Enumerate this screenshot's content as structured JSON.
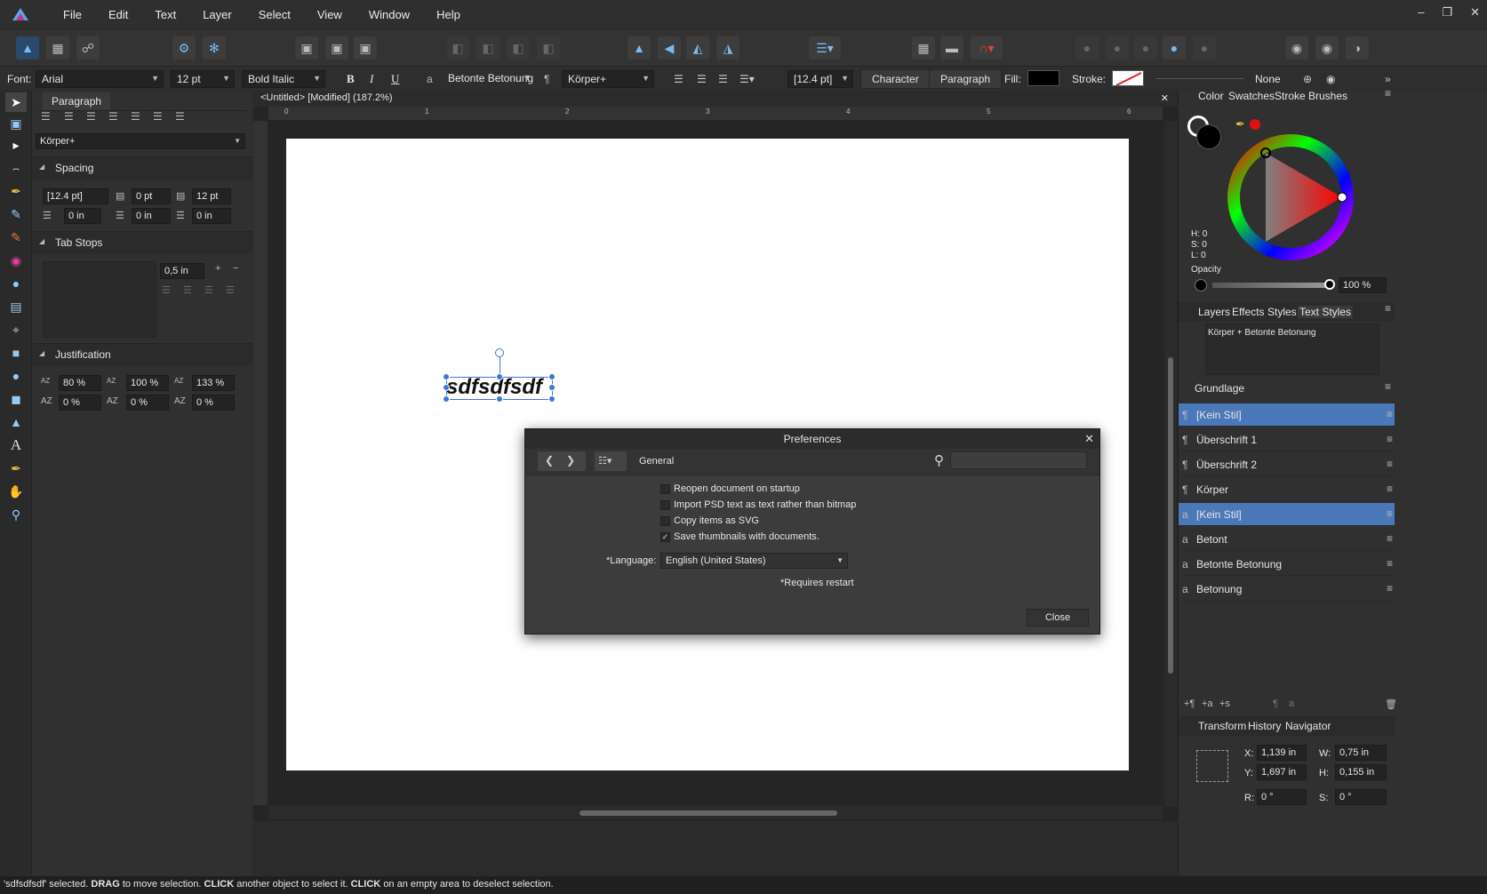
{
  "menu": [
    "File",
    "Edit",
    "Text",
    "Layer",
    "Select",
    "View",
    "Window",
    "Help"
  ],
  "context": {
    "font_label": "Font:",
    "font": "Arial",
    "size": "12 pt",
    "style": "Bold Italic",
    "bold": "B",
    "italic": "I",
    "underline": "U",
    "char_style": "Betonte Betonung",
    "para_style": "Körper+",
    "leading": "[12.4 pt]",
    "character_btn": "Character",
    "paragraph_btn": "Paragraph",
    "fill_label": "Fill:",
    "stroke_label": "Stroke:",
    "stroke_value": "None",
    "colors": {
      "fill": "#000000",
      "stroke_bg": "#ffffff",
      "stroke_slash": "#e02020"
    }
  },
  "paragraph_panel": {
    "tab": "Paragraph",
    "style": "Körper+",
    "spacing": {
      "title": "Spacing",
      "leading": "[12.4 pt]",
      "space_before": "0 pt",
      "space_after": "12 pt",
      "left_indent": "0 in",
      "first_indent": "0 in",
      "right_indent": "0 in"
    },
    "tab_stops": {
      "title": "Tab Stops",
      "value": "0,5 in"
    },
    "justification": {
      "title": "Justification",
      "word_min": "80 %",
      "word_desired": "100 %",
      "word_max": "133 %",
      "letter_min": "0 %",
      "letter_desired": "0 %",
      "letter_max": "0 %"
    }
  },
  "document": {
    "tab_title": "<Untitled> [Modified] (187.2%)",
    "ruler_h": [
      "0",
      "1",
      "2",
      "3",
      "4",
      "5",
      "6"
    ],
    "selected_text": "sdfsdfsdf"
  },
  "color_panel": {
    "tabs": [
      "Color",
      "Swatches",
      "Stroke",
      "Brushes"
    ],
    "h": "H: 0",
    "s": "S: 0",
    "l": "L: 0",
    "opacity_label": "Opacity",
    "opacity_value": "100 %",
    "opacity": 1.0
  },
  "styles_panel": {
    "tabs": [
      "Layers",
      "Effects",
      "Styles",
      "Text Styles"
    ],
    "current": "Körper + Betonte Betonung",
    "group": "Grundlage",
    "items": [
      {
        "glyph": "¶",
        "label": "[Kein Stil]",
        "selected": true
      },
      {
        "glyph": "¶",
        "label": "Überschrift 1",
        "selected": false
      },
      {
        "glyph": "¶",
        "label": "Überschrift 2",
        "selected": false
      },
      {
        "glyph": "¶",
        "label": "Körper",
        "selected": false
      },
      {
        "glyph": "a",
        "label": "[Kein Stil]",
        "selected": true
      },
      {
        "glyph": "a",
        "label": "Betont",
        "selected": false
      },
      {
        "glyph": "a",
        "label": "Betonte Betonung",
        "selected": false
      },
      {
        "glyph": "a",
        "label": "Betonung",
        "selected": false
      }
    ]
  },
  "transform_panel": {
    "tabs": [
      "Transform",
      "History",
      "Navigator"
    ],
    "x_label": "X:",
    "x": "1,139 in",
    "y_label": "Y:",
    "y": "1,697 in",
    "w_label": "W:",
    "w": "0,75 in",
    "h_label": "H:",
    "h": "0,155 in",
    "r_label": "R:",
    "r": "0 °",
    "s_label": "S:",
    "s": "0 °"
  },
  "preferences": {
    "title": "Preferences",
    "section": "General",
    "options": [
      {
        "label": "Reopen document on startup",
        "checked": false
      },
      {
        "label": "Import PSD text as text rather than bitmap",
        "checked": false
      },
      {
        "label": "Copy items as SVG",
        "checked": false
      },
      {
        "label": "Save thumbnails with documents.",
        "checked": true
      }
    ],
    "language_label": "*Language:",
    "language": "English (United States)",
    "restart_note": "*Requires restart",
    "close_btn": "Close"
  },
  "status": {
    "selected": "'sdfsdfsdf' selected.",
    "drag": "DRAG",
    "t1": "to move selection.",
    "click1": "CLICK",
    "t2": "another object to select it.",
    "click2": "CLICK",
    "t3": "on an empty area to deselect selection."
  }
}
